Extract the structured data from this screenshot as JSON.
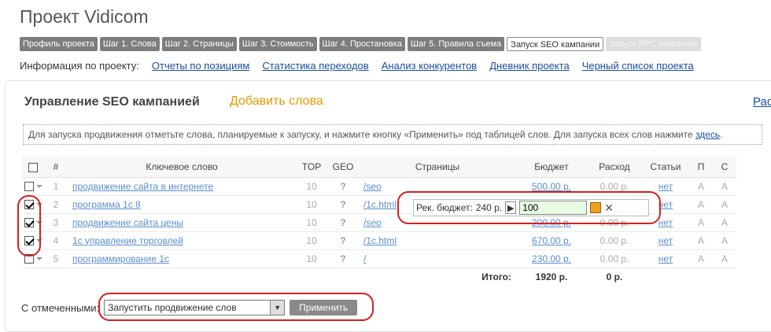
{
  "project": {
    "title": "Проект Vidicom"
  },
  "steps": [
    {
      "label": "Профиль проекта",
      "state": "normal"
    },
    {
      "label": "Шаг 1. Слова",
      "state": "normal"
    },
    {
      "label": "Шаг 2. Страницы",
      "state": "normal"
    },
    {
      "label": "Шаг 3. Стоимость",
      "state": "normal"
    },
    {
      "label": "Шаг 4. Простановка",
      "state": "normal"
    },
    {
      "label": "Шаг 5. Правила съема",
      "state": "normal"
    },
    {
      "label": "Запуск SEO кампании",
      "state": "active"
    },
    {
      "label": "Запуск PPC кампании",
      "state": "disabled"
    }
  ],
  "info": {
    "label": "Информация по проекту:",
    "links": [
      "Отчеты по позициям",
      "Статистика переходов",
      "Анализ конкурентов",
      "Дневник проекта",
      "Черный список проекта"
    ]
  },
  "panel": {
    "title": "Управление SEO кампанией",
    "add_words": "Добавить слова",
    "right_link": "Рас",
    "hint": "Для запуска продвижения отметьте слова, планируемые к запуску, и нажмите кнопку «Применить» под таблицей слов. Для запуска всех слов нажмите ",
    "hint_link": "здесь",
    "hint_end": "."
  },
  "table": {
    "headers": [
      "#",
      "Ключевое слово",
      "TOP",
      "GEO",
      "Страницы",
      "Бюджет",
      "Расход",
      "Статьи",
      "П",
      "С"
    ],
    "rows": [
      {
        "n": "1",
        "keyword": "продвижение сайта в интернете",
        "top": "10",
        "geo": "?",
        "page": "/seo",
        "budget": "500.00 р.",
        "spend": "0.00 р.",
        "articles": "нет",
        "p": "A",
        "c": "A",
        "checked": false
      },
      {
        "n": "2",
        "keyword": "программа 1с 8",
        "top": "10",
        "geo": "?",
        "page": "/1c.html",
        "budget": "",
        "spend": "",
        "articles": "нет",
        "p": "A",
        "c": "A",
        "checked": true
      },
      {
        "n": "3",
        "keyword": "продвижение сайта цены",
        "top": "10",
        "geo": "?",
        "page": "/seo",
        "budget": "200.00 р.",
        "spend": "0.00 р.",
        "articles": "нет",
        "p": "A",
        "c": "A",
        "checked": true
      },
      {
        "n": "4",
        "keyword": "1с управление торговлей",
        "top": "10",
        "geo": "?",
        "page": "/1c.html",
        "budget": "670.00 р.",
        "spend": "0.00 р.",
        "articles": "нет",
        "p": "A",
        "c": "A",
        "checked": true
      },
      {
        "n": "5",
        "keyword": "программирование 1с",
        "top": "10",
        "geo": "?",
        "page": "/",
        "budget": "230.00 р.",
        "spend": "0.00 р.",
        "articles": "нет",
        "p": "A",
        "c": "A",
        "checked": false
      }
    ],
    "total_label": "Итого:",
    "total_budget": "1920 р.",
    "total_spend": "0 р."
  },
  "popup": {
    "label": "Рек. бюджет:",
    "recommended": "240 р.",
    "input_value": "100"
  },
  "bottom": {
    "label": "С отмеченными:",
    "select_value": "Запустить продвижение слов",
    "apply_label": "Применить"
  }
}
